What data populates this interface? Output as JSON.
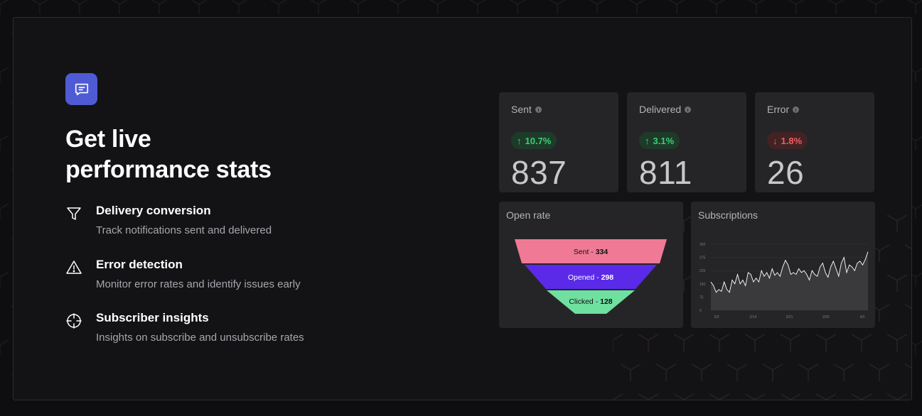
{
  "headline": {
    "line1": "Get live",
    "line2": "performance stats"
  },
  "features": [
    {
      "title": "Delivery conversion",
      "description": "Track notifications sent and delivered",
      "icon": "funnel-icon"
    },
    {
      "title": "Error detection",
      "description": "Monitor error rates and identify issues early",
      "icon": "warning-triangle-icon"
    },
    {
      "title": "Subscriber insights",
      "description": "Insights on subscribe and unsubscribe rates",
      "icon": "crosshair-icon"
    }
  ],
  "stats": [
    {
      "label": "Sent",
      "change": "10.7%",
      "direction": "up",
      "value": "837"
    },
    {
      "label": "Delivered",
      "change": "3.1%",
      "direction": "up",
      "value": "811"
    },
    {
      "label": "Error",
      "change": "1.8%",
      "direction": "down",
      "value": "26"
    }
  ],
  "open_rate": {
    "title": "Open rate",
    "stages": [
      {
        "label": "Sent - ",
        "value": "334",
        "color": "#f07a96"
      },
      {
        "label": "Opened - ",
        "value": "298",
        "color": "#5b2ae8"
      },
      {
        "label": "Clicked - ",
        "value": "128",
        "color": "#6fe0a0"
      }
    ]
  },
  "subscriptions": {
    "title": "Subscriptions"
  },
  "colors": {
    "accent": "#4f5bd5",
    "positive": "#3ccf72",
    "negative": "#ee5f62"
  },
  "chart_data": {
    "type": "area",
    "title": "Subscriptions",
    "ylim": [
      0,
      350
    ],
    "yticks": [
      "350",
      "275",
      "225",
      "150",
      "75",
      "0"
    ],
    "xticks": [
      "2/3",
      "2/14",
      "3/21",
      "3/30",
      "4/3"
    ],
    "values": [
      150,
      130,
      95,
      110,
      100,
      150,
      110,
      95,
      160,
      140,
      190,
      140,
      160,
      130,
      200,
      190,
      150,
      170,
      150,
      210,
      180,
      200,
      170,
      220,
      185,
      200,
      180,
      230,
      265,
      240,
      190,
      200,
      190,
      220,
      200,
      210,
      190,
      160,
      210,
      190,
      180,
      230,
      250,
      200,
      175,
      230,
      260,
      220,
      180,
      250,
      280,
      200,
      240,
      230,
      210,
      250,
      260,
      240,
      270,
      310
    ]
  }
}
